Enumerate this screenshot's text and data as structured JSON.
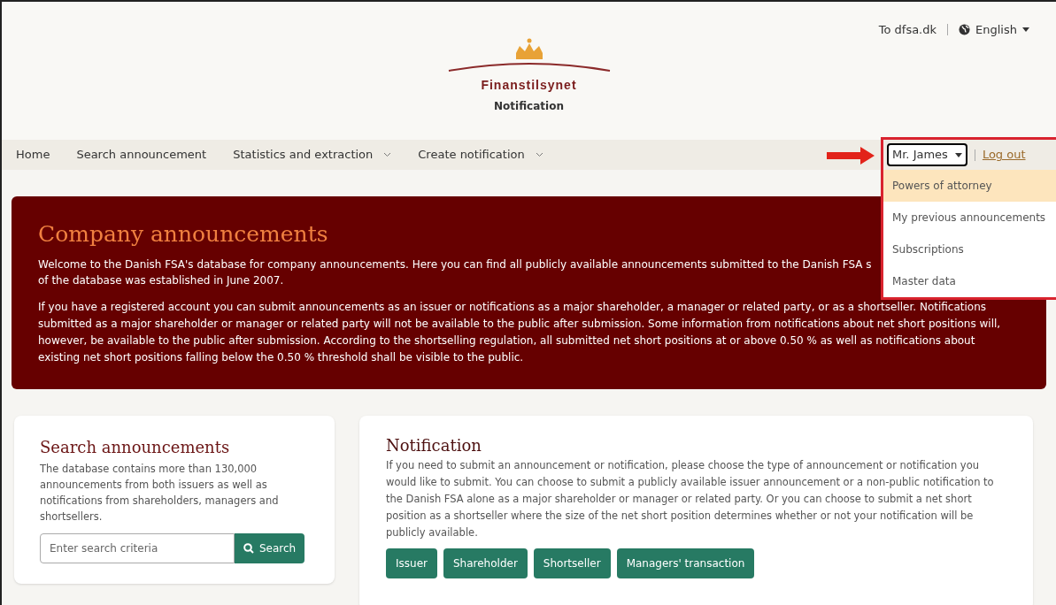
{
  "top_links": {
    "site_link": "To dfsa.dk",
    "language": "English"
  },
  "logo": {
    "name": "Finanstilsynet",
    "subtitle": "Notification"
  },
  "nav": [
    {
      "label": "Home",
      "has_menu": false
    },
    {
      "label": "Search announcement",
      "has_menu": false
    },
    {
      "label": "Statistics and extraction",
      "has_menu": true
    },
    {
      "label": "Create notification",
      "has_menu": true
    }
  ],
  "user_menu": {
    "user": "Mr. James",
    "logout": "Log out",
    "expanded": true,
    "items": [
      {
        "label": "Powers of attorney",
        "selected": true
      },
      {
        "label": "My previous announcements",
        "selected": false
      },
      {
        "label": "Subscriptions",
        "selected": false
      },
      {
        "label": "Master data",
        "selected": false
      }
    ]
  },
  "banner": {
    "title": "Company announcements",
    "lines": [
      "Welcome to the Danish FSA's database for company announcements. Here you can find all publicly available announcements submitted to the Danish FSA s",
      "of the database was established in June 2007."
    ],
    "paragraph": "If you have a registered account you can submit announcements as an issuer or notifications as a major shareholder, a manager or related party, or as a shortseller. Notifications submitted as a major shareholder or manager or related party will not be available to the public after submission. Some information from notifications about net short positions will, however, be available to the public after submission. According to the shortselling regulation, all submitted net short positions at or above 0.50 % as well as notifications about existing net short positions falling below the 0.50 % threshold shall be visible to the public."
  },
  "search_card": {
    "title": "Search announcements",
    "text": "The database contains more than 130,000 announcements from both issuers as well as notifications from shareholders, managers and shortsellers.",
    "placeholder": "Enter search criteria",
    "button": "Search"
  },
  "notification_card": {
    "title": "Notification",
    "text": "If you need to submit an announcement or notification, please choose the type of announcement or notification you would like to submit. You can choose to submit a publicly available issuer announcement or a non-public notification to the Danish FSA alone as a major shareholder or manager or related party. Or you can choose to submit a net short position as a shortseller where the size of the net short position determines whether or not your notification will be publicly available.",
    "buttons": [
      "Issuer",
      "Shareholder",
      "Shortseller",
      "Managers' transaction"
    ]
  }
}
